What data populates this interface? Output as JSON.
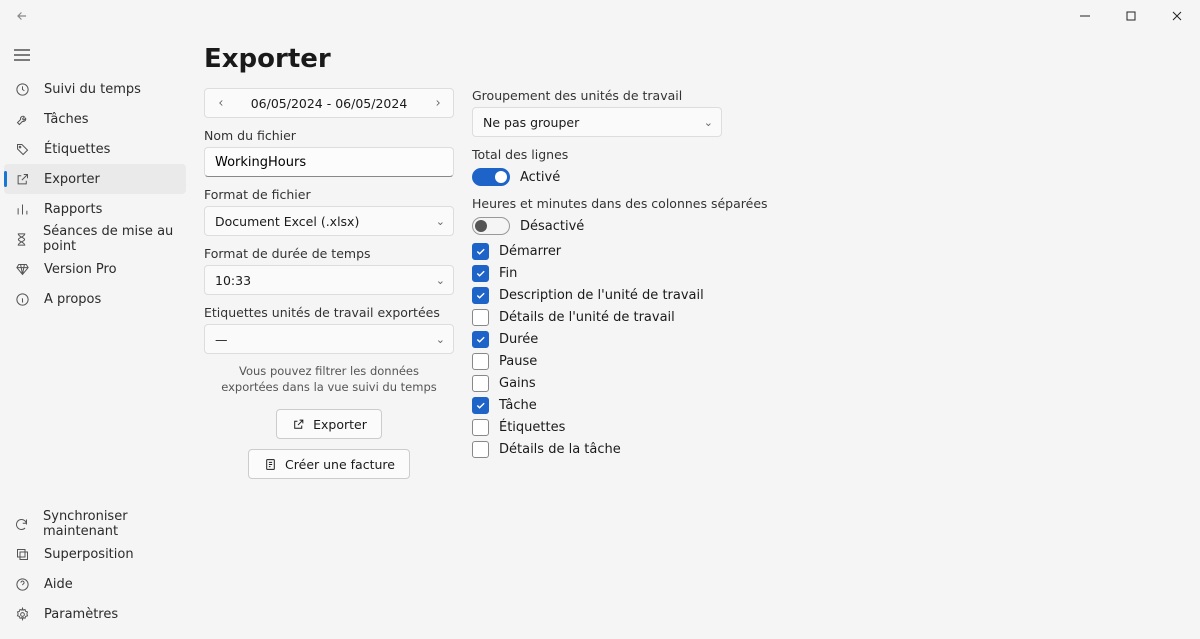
{
  "titlebar": {
    "back": "←"
  },
  "sidebar": {
    "top": [
      {
        "label": "Suivi du temps"
      },
      {
        "label": "Tâches"
      },
      {
        "label": "Étiquettes"
      },
      {
        "label": "Exporter"
      },
      {
        "label": "Rapports"
      },
      {
        "label": "Séances de mise au point"
      },
      {
        "label": "Version Pro"
      },
      {
        "label": "A propos"
      }
    ],
    "bottom": [
      {
        "label": "Synchroniser maintenant"
      },
      {
        "label": "Superposition"
      },
      {
        "label": "Aide"
      },
      {
        "label": "Paramètres"
      }
    ]
  },
  "page": {
    "title": "Exporter",
    "date_range": "06/05/2024 - 06/05/2024",
    "filename_label": "Nom du fichier",
    "filename_value": "WorkingHours",
    "fileformat_label": "Format de fichier",
    "fileformat_value": "Document Excel (.xlsx)",
    "duration_label": "Format de durée de temps",
    "duration_value": "10:33",
    "taglabels_label": "Etiquettes unités de travail exportées",
    "taglabels_value": "—",
    "hint": "Vous pouvez filtrer les données exportées dans la vue suivi du temps",
    "export_btn": "Exporter",
    "invoice_btn": "Créer une facture",
    "grouping_label": "Groupement des unités de travail",
    "grouping_value": "Ne pas grouper",
    "totals_label": "Total des lignes",
    "totals_state": "Activé",
    "hm_label": "Heures et minutes dans des colonnes séparées",
    "hm_state": "Désactivé",
    "columns": [
      {
        "label": "Démarrer",
        "checked": true
      },
      {
        "label": "Fin",
        "checked": true
      },
      {
        "label": "Description de l'unité de travail",
        "checked": true
      },
      {
        "label": "Détails de l'unité de travail",
        "checked": false
      },
      {
        "label": "Durée",
        "checked": true
      },
      {
        "label": "Pause",
        "checked": false
      },
      {
        "label": "Gains",
        "checked": false
      },
      {
        "label": "Tâche",
        "checked": true
      },
      {
        "label": "Étiquettes",
        "checked": false
      },
      {
        "label": "Détails de la tâche",
        "checked": false
      }
    ]
  }
}
